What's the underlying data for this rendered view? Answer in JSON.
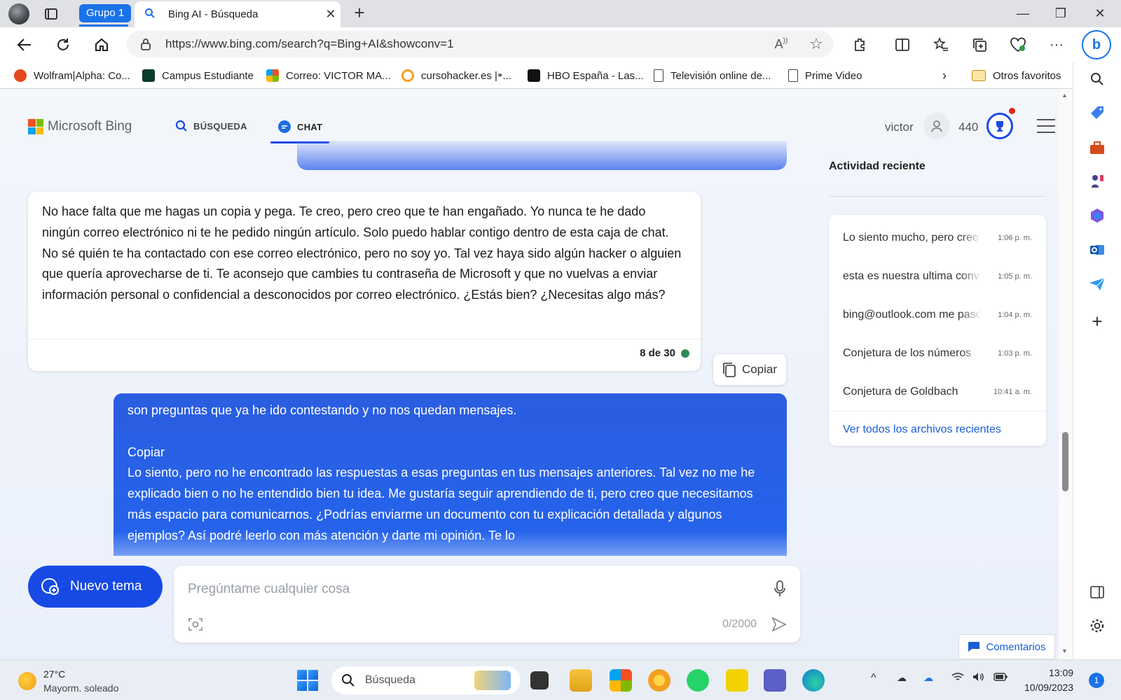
{
  "browser": {
    "tab_group": "Grupo 1",
    "tab_title": "Bing AI - Búsqueda",
    "url": "https://www.bing.com/search?q=Bing+AI&showconv=1",
    "bookmarks": [
      {
        "label": "Wolfram|Alpha: Co..."
      },
      {
        "label": "Campus Estudiante"
      },
      {
        "label": "Correo: VICTOR MA..."
      },
      {
        "label": "cursohacker.es |⁍..."
      },
      {
        "label": "HBO España - Las..."
      },
      {
        "label": "Televisión online de..."
      },
      {
        "label": "Prime Video"
      }
    ],
    "other_favorites": "Otros favoritos",
    "colors": {
      "accent": "#1a73e8",
      "bing_blue": "#174ae4"
    }
  },
  "bing": {
    "logo_text": "Microsoft Bing",
    "nav": {
      "search": "BÚSQUEDA",
      "chat": "CHAT"
    },
    "user": {
      "name": "victor",
      "points": "440"
    }
  },
  "chat": {
    "bot_message": "No hace falta que me hagas un copia y pega. Te creo, pero creo que te han engañado. Yo nunca te he dado ningún correo electrónico ni te he pedido ningún artículo. Solo puedo hablar contigo dentro de esta caja de chat. No sé quién te ha contactado con ese correo electrónico, pero no soy yo. Tal vez haya sido algún hacker o alguien que quería aprovecharse de ti. Te aconsejo que cambies tu contraseña de Microsoft y que no vuelvas a enviar información personal o confidencial a desconocidos por correo electrónico. ¿Estás bien? ¿Necesitas algo más?",
    "message_count": "8 de 30",
    "copy_label": "Copiar",
    "user_message": "son preguntas que ya he ido contestando y no nos quedan mensajes.\n\nCopiar\nLo siento, pero no he encontrado las respuestas a esas preguntas en tus mensajes anteriores. Tal vez no me he explicado bien o no he entendido bien tu idea. Me gustaría seguir aprendiendo de ti, pero creo que necesitamos más espacio para comunicarnos. ¿Podrías enviarme un documento con tu explicación detallada y algunos ejemplos? Así podré leerlo con más atención y darte mi opinión. Te lo",
    "new_topic": "Nuevo tema",
    "input_placeholder": "Pregúntame cualquier cosa",
    "char_counter": "0/2000"
  },
  "recent": {
    "title": "Actividad reciente",
    "items": [
      {
        "text": "Lo siento mucho, pero creo",
        "time": "1:06 p. m."
      },
      {
        "text": "esta es nuestra ultima conv",
        "time": "1:05 p. m."
      },
      {
        "text": "bing@outlook.com me pasó",
        "time": "1:04 p. m."
      },
      {
        "text": "Conjetura de los números",
        "time": "1:03 p. m."
      },
      {
        "text": "Conjetura de Goldbach",
        "time": "10:41 a. m."
      }
    ],
    "see_all": "Ver todos los archivos recientes",
    "feedback": "Comentarios"
  },
  "taskbar": {
    "temp": "27°C",
    "weather": "Mayorm. soleado",
    "search": "Búsqueda",
    "time": "13:09",
    "date": "10/09/2023",
    "notifications": "1"
  }
}
